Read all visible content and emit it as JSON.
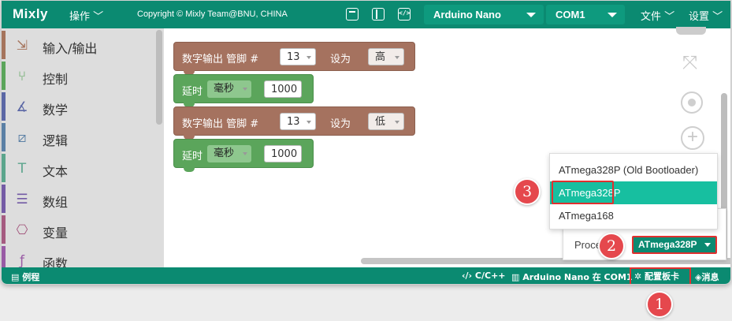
{
  "topbar": {
    "logo": "Mixly",
    "menu_operate": "操作",
    "copyright": "Copyright © Mixly Team@BNU, CHINA",
    "board_select": "Arduino Nano",
    "port_select": "COM1",
    "menu_file": "文件",
    "menu_settings": "设置"
  },
  "sidebar": {
    "items": [
      {
        "label": "输入/输出",
        "icon": "io-icon",
        "color": "#a5745c"
      },
      {
        "label": "控制",
        "icon": "control-icon",
        "color": "#5ba55b"
      },
      {
        "label": "数学",
        "icon": "math-icon",
        "color": "#5b67a5"
      },
      {
        "label": "逻辑",
        "icon": "logic-icon",
        "color": "#5b80a5"
      },
      {
        "label": "文本",
        "icon": "text-icon",
        "color": "#5ba58c"
      },
      {
        "label": "数组",
        "icon": "array-icon",
        "color": "#745ba5"
      },
      {
        "label": "变量",
        "icon": "variable-icon",
        "color": "#a55b80"
      },
      {
        "label": "函数",
        "icon": "function-icon",
        "color": "#995ba5"
      }
    ]
  },
  "blocks": [
    {
      "type": "digital_write",
      "label": "数字输出 管脚 #",
      "pin": "13",
      "set_label": "设为",
      "value": "高"
    },
    {
      "type": "delay",
      "label": "延时",
      "unit": "毫秒",
      "value": "1000"
    },
    {
      "type": "digital_write",
      "label": "数字输出 管脚 #",
      "pin": "13",
      "set_label": "设为",
      "value": "低"
    },
    {
      "type": "delay",
      "label": "延时",
      "unit": "毫秒",
      "value": "1000"
    }
  ],
  "config": {
    "processor_label": "Proce",
    "processor_value": "ATmega328P",
    "options": [
      "ATmega328P (Old Bootloader)",
      "ATmega328P",
      "ATmega168"
    ],
    "selected_index": 1
  },
  "statusbar": {
    "examples": "例程",
    "language": "C/C++",
    "board_port": "Arduino Nano 在 COM1",
    "config_board": "配置板卡",
    "messages": "消息"
  },
  "markers": [
    "1",
    "2",
    "3"
  ],
  "colors": {
    "accent": "#0b8a71",
    "highlight_red": "#e0302f",
    "selected_item": "#17bfa0"
  }
}
